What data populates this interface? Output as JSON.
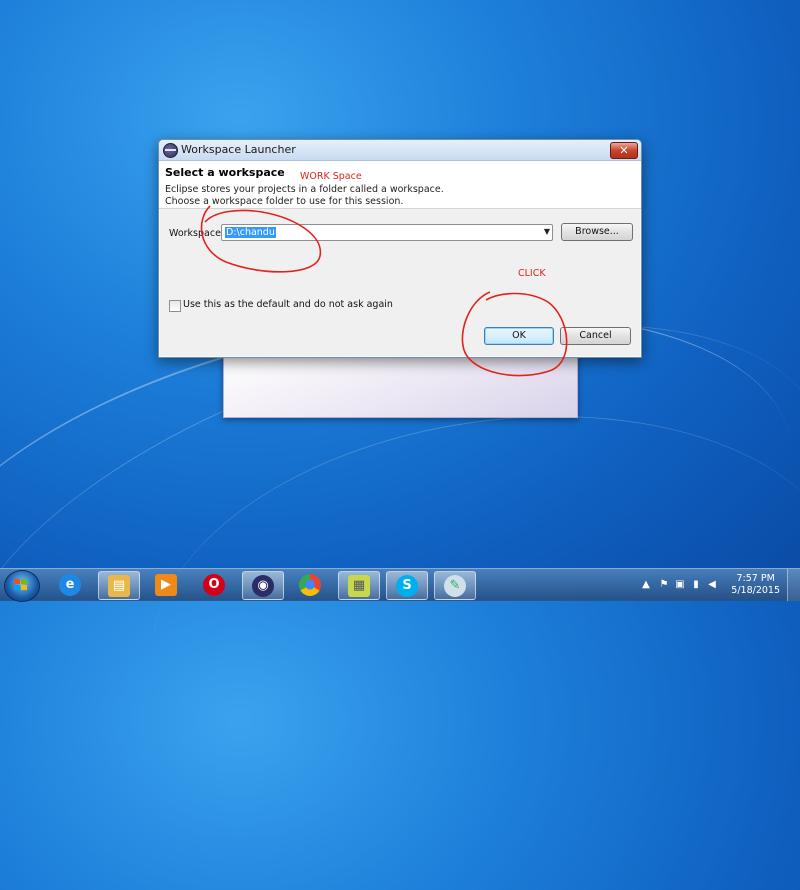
{
  "dialog": {
    "title": "Workspace Launcher",
    "close_glyph": "✕",
    "heading": "Select a workspace",
    "desc_line1": "Eclipse stores your projects in a folder called a workspace.",
    "desc_line2": "Choose a workspace folder to use for this session.",
    "workspace_label": "Workspace:",
    "workspace_value": "D:\\chandu",
    "browse_label": "Browse...",
    "default_checkbox_label": "Use this as the default and do not ask again",
    "default_checked": false,
    "ok_label": "OK",
    "cancel_label": "Cancel"
  },
  "annotations": {
    "workspace_note": "WORK Space",
    "click_note": "CLICK",
    "color": "#e0241c"
  },
  "taskbar": {
    "items": [
      {
        "name": "internet-explorer",
        "glyph": "e",
        "color": "#1e88e5"
      },
      {
        "name": "file-explorer",
        "glyph": "▤",
        "color": "#e8b84a"
      },
      {
        "name": "media-player",
        "glyph": "▶",
        "color": "#ef8a1a"
      },
      {
        "name": "opera",
        "glyph": "O",
        "color": "#d0021b"
      },
      {
        "name": "eclipse",
        "glyph": "◉",
        "color": "#2c2c66"
      },
      {
        "name": "chrome",
        "glyph": "●",
        "color": "#34a853"
      },
      {
        "name": "sticky-notes",
        "glyph": "▦",
        "color": "#c8d84a"
      },
      {
        "name": "skype",
        "glyph": "S",
        "color": "#00aff0"
      },
      {
        "name": "paint",
        "glyph": "✎",
        "color": "#8aa"
      }
    ],
    "clock_time": "7:57 PM",
    "clock_date": "5/18/2015",
    "tray_expand_glyph": "▲"
  }
}
